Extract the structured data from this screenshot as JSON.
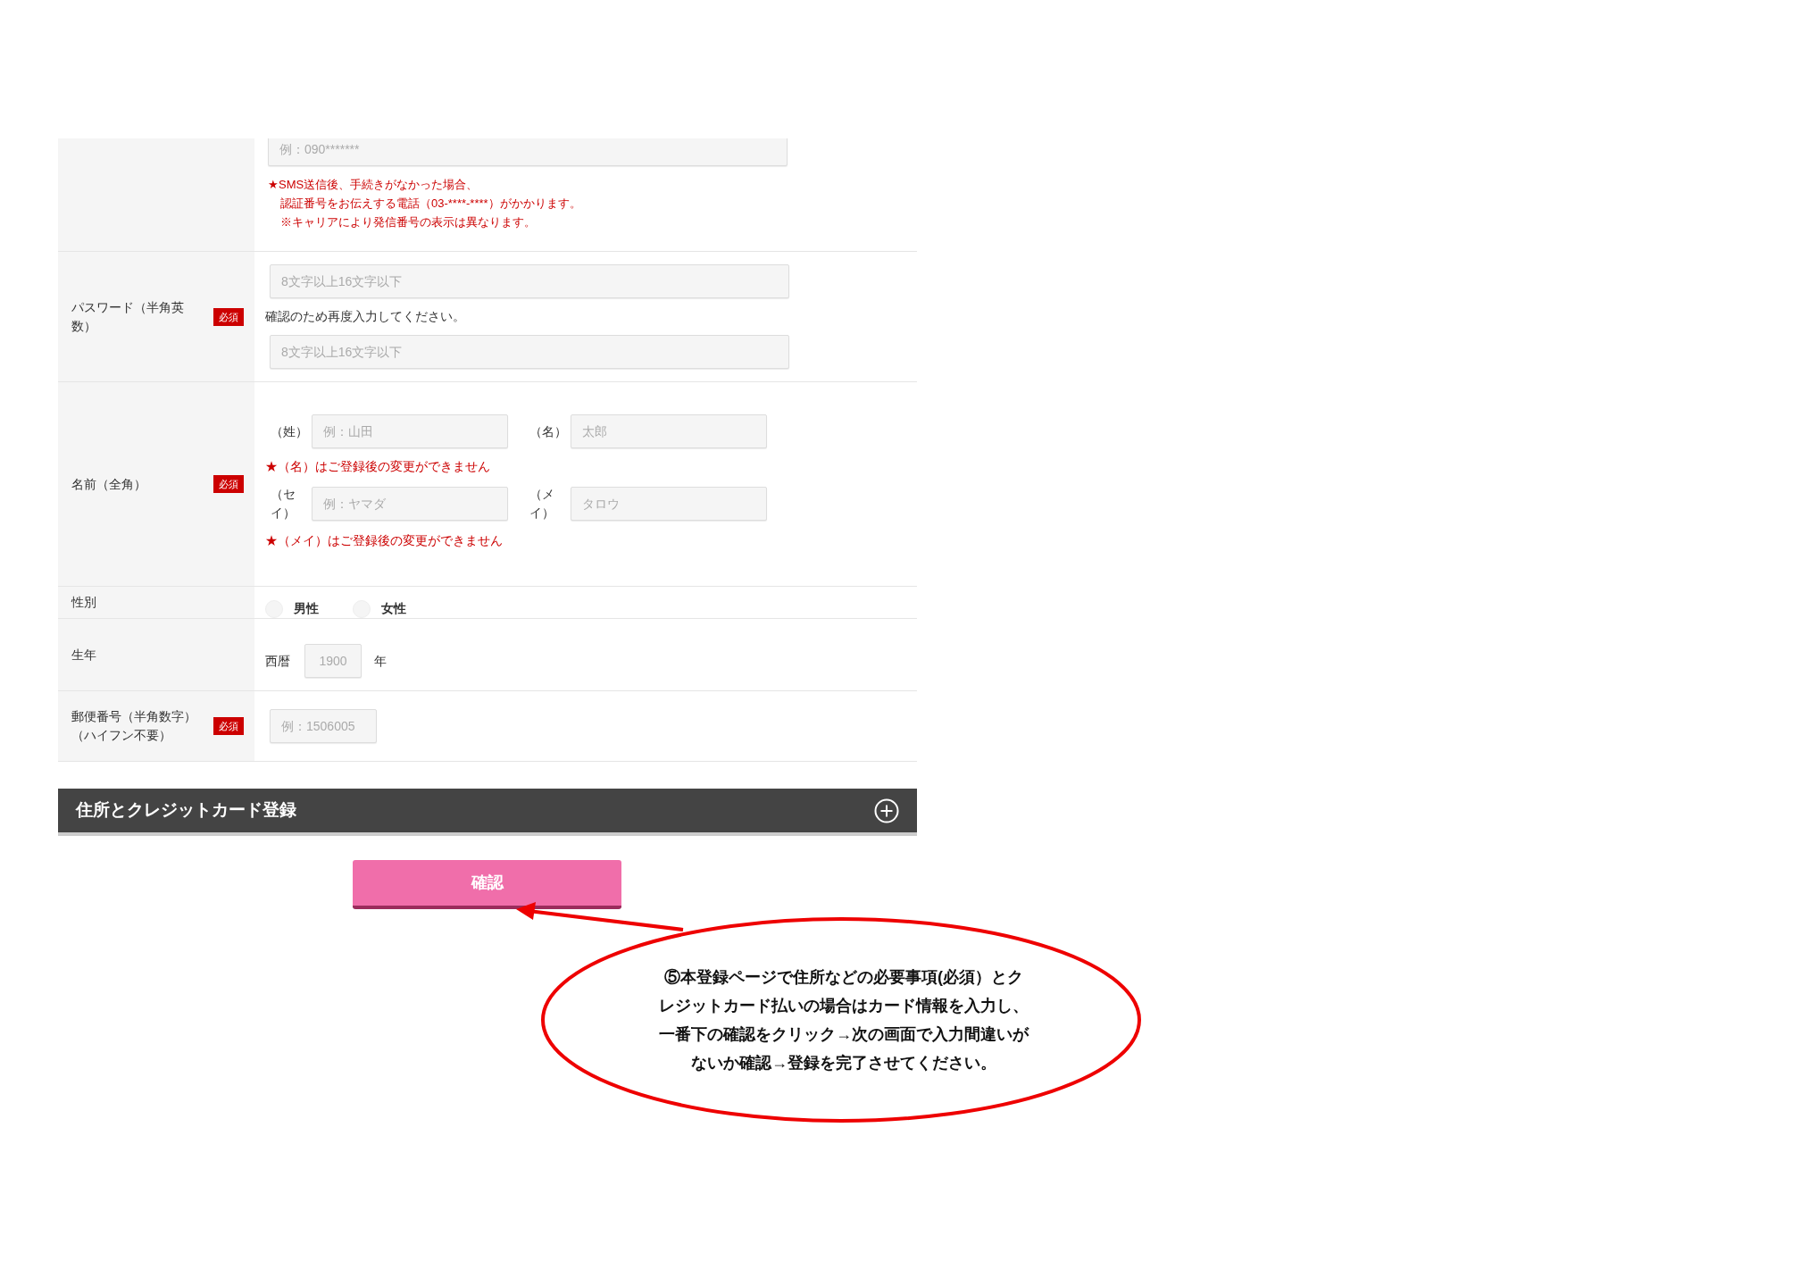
{
  "form_rows": [
    {
      "kind": "phone",
      "label_lines": [],
      "placeholder": "例：090*******",
      "note_lines": [
        "★SMS送信後、手続きがなかった場合、",
        "認証番号をお伝えする電話（03-****-****）がかかります。",
        "※キャリアにより発信番号の表示は異なります。"
      ]
    },
    {
      "kind": "password",
      "label_lines": [
        "パスワード（半角英",
        "数）"
      ],
      "badge": "必須",
      "placeholder": "8文字以上16文字以下",
      "instruction": "確認のため再度入力してください。",
      "confirm_placeholder": "8文字以上16文字以下"
    },
    {
      "kind": "name",
      "label_lines": [
        "名前（全角）"
      ],
      "badge": "必須",
      "lines": [
        {
          "kind": "pair",
          "fields": [
            {
              "label": "（姓）",
              "placeholder": "例：山田"
            },
            {
              "label": "（名）",
              "placeholder": "太郎"
            }
          ]
        },
        {
          "kind": "warning",
          "text": "★（名）はご登録後の変更ができません"
        },
        {
          "kind": "pair",
          "fields": [
            {
              "label": "（セイ）",
              "placeholder": "例：ヤマダ"
            },
            {
              "label": "（メイ）",
              "placeholder": "タロウ"
            }
          ]
        },
        {
          "kind": "warning",
          "text": "★（メイ）はご登録後の変更ができません"
        }
      ]
    },
    {
      "kind": "gender",
      "label_lines": [
        "性別"
      ],
      "options": [
        {
          "label": "男性",
          "selected": false
        },
        {
          "label": "女性",
          "selected": false
        }
      ]
    },
    {
      "kind": "birth",
      "label_lines": [
        "生年"
      ],
      "prefix": "西暦",
      "placeholder": "1900",
      "suffix": "年"
    },
    {
      "kind": "postal",
      "label_lines": [
        "郵便番号（半角数字）",
        "（ハイフン不要）"
      ],
      "badge": "必須",
      "placeholder": "例：1506005"
    }
  ],
  "section": {
    "title": "住所とクレジットカード登録",
    "expanded": false
  },
  "confirm_button": "確認",
  "annotation": {
    "lines": [
      "⑤本登録ページで住所などの必要事項(必須）とク",
      "レジットカード払いの場合はカード情報を入力し、",
      "一番下の確認をクリック→次の画面で入力間違いが",
      "ないか確認→登録を完了させてください。"
    ]
  }
}
